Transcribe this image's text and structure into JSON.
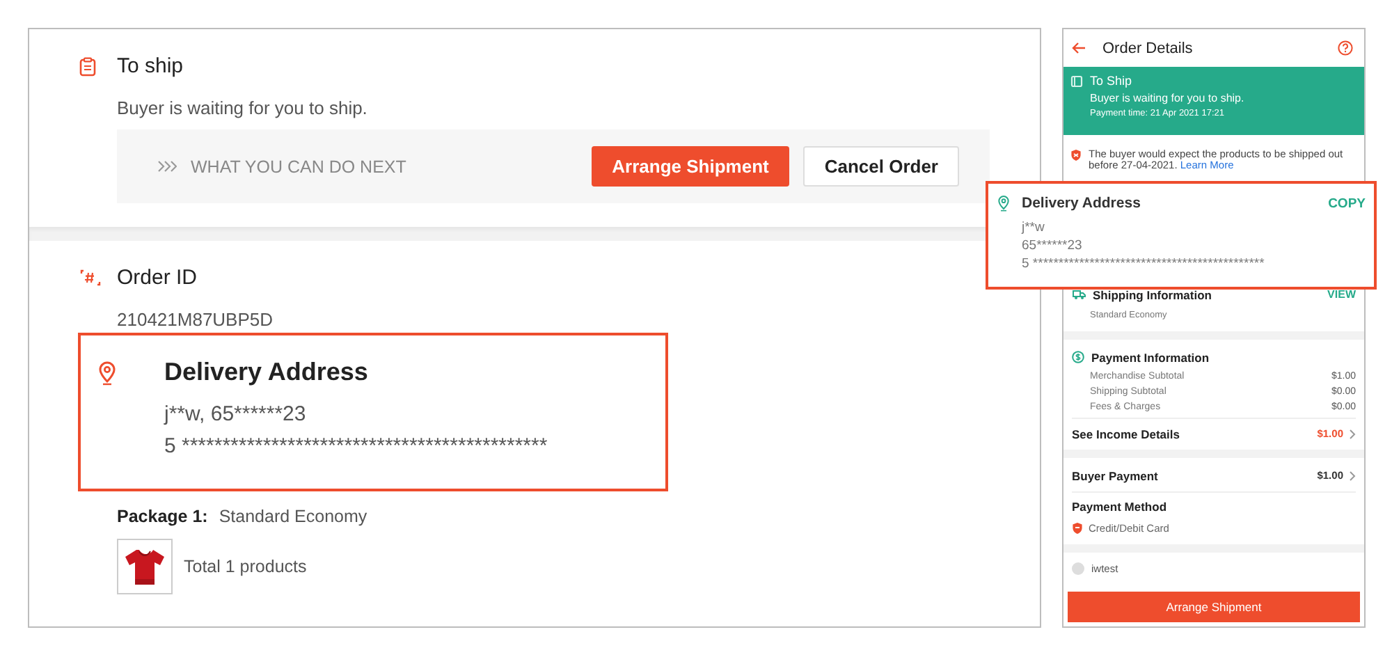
{
  "desktop": {
    "status": {
      "title": "To ship",
      "message": "Buyer is waiting for you to ship.",
      "next_label": "WHAT YOU CAN DO NEXT",
      "buttons": [
        {
          "label": "Arrange Shipment",
          "kind": "primary"
        },
        {
          "label": "Cancel Order",
          "kind": "secondary"
        }
      ]
    },
    "order": {
      "title": "Order ID",
      "id": "210421M87UBP5D"
    },
    "package": {
      "label": "Package 1:",
      "value": "Standard Economy",
      "summary": "Total 1 products"
    },
    "address_callout": {
      "title": "Delivery Address",
      "lines": [
        "j**w, 65******23",
        "5 *********************************************"
      ]
    }
  },
  "mobile": {
    "header": {
      "title": "Order Details"
    },
    "status": {
      "title": "To Ship",
      "message": "Buyer is waiting for you to ship.",
      "payment_time": "Payment time: 21 Apr 2021 17:21"
    },
    "notice": {
      "text": "The buyer would expect the products to be shipped out before 27-04-2021.",
      "link": "Learn More"
    },
    "shipping": {
      "title": "Shipping Information",
      "action": "VIEW",
      "value": "Standard Economy"
    },
    "payment": {
      "title": "Payment Information",
      "rows": [
        {
          "label": "Merchandise Subtotal",
          "value": "$1.00"
        },
        {
          "label": "Shipping Subtotal",
          "value": "$0.00"
        },
        {
          "label": "Fees & Charges",
          "value": "$0.00"
        }
      ]
    },
    "income": {
      "label": "See Income Details",
      "value": "$1.00"
    },
    "buyer_payment": {
      "label": "Buyer Payment",
      "value": "$1.00"
    },
    "payment_method": {
      "title": "Payment Method",
      "value": "Credit/Debit Card"
    },
    "buyer": {
      "name": "iwtest"
    },
    "button": "Arrange Shipment",
    "address_callout": {
      "title": "Delivery Address",
      "action": "COPY",
      "lines": [
        "j**w",
        "65******23",
        "5 *********************************************"
      ]
    }
  }
}
